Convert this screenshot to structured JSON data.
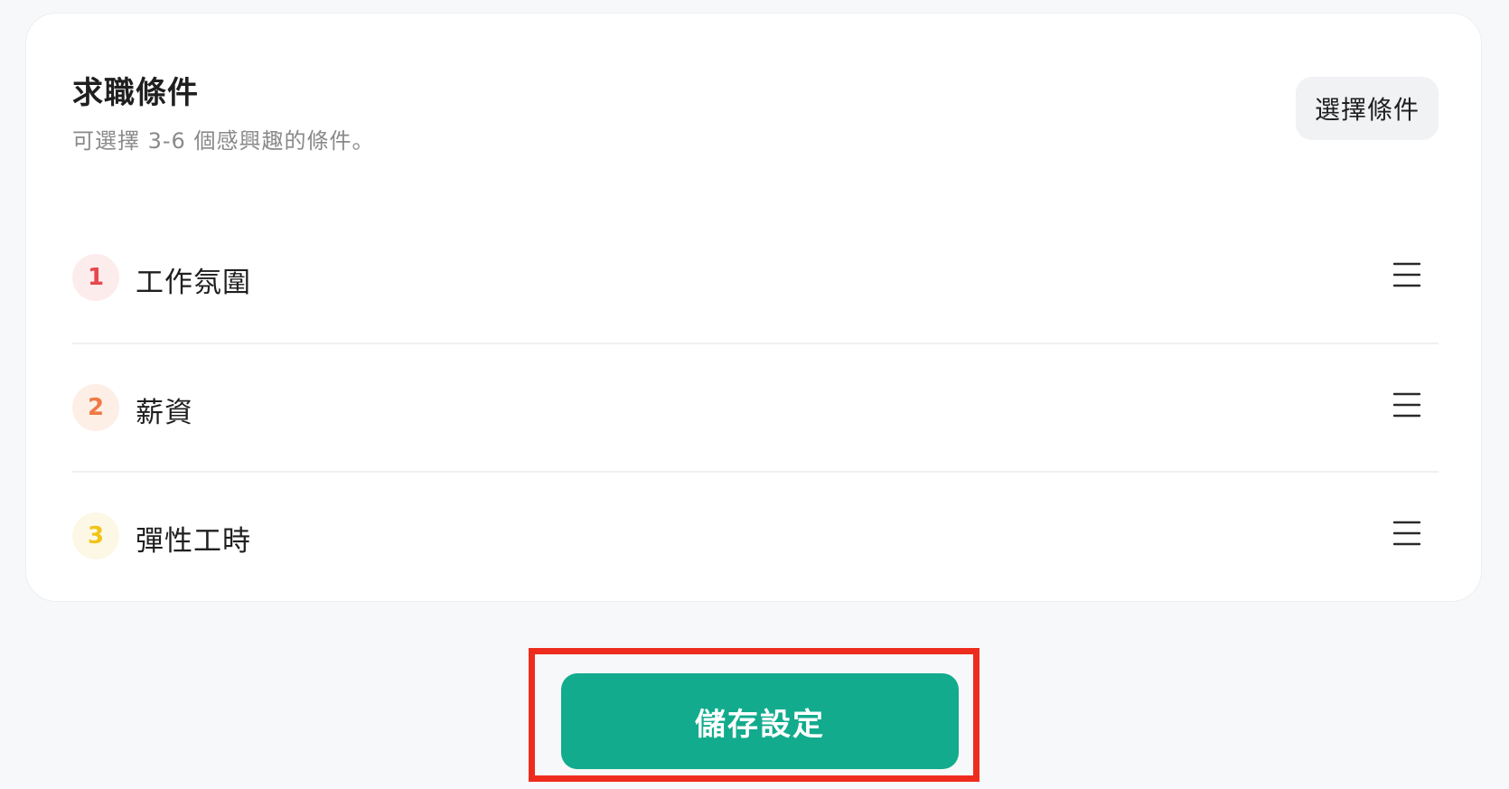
{
  "card": {
    "title": "求職條件",
    "subtitle": "可選擇 3-6 個感興趣的條件。",
    "select_label": "選擇條件"
  },
  "conditions": [
    {
      "number": "1",
      "label": "工作氛圍",
      "badge_bg": "#fdecec",
      "badge_color": "#e5484d"
    },
    {
      "number": "2",
      "label": "薪資",
      "badge_bg": "#fdeee6",
      "badge_color": "#ee7a45"
    },
    {
      "number": "3",
      "label": "彈性工時",
      "badge_bg": "#fdf8e6",
      "badge_color": "#f0c419"
    }
  ],
  "actions": {
    "save_label": "儲存設定"
  },
  "colors": {
    "primary": "#12ab8d",
    "highlight": "#ee2c1e"
  },
  "icons": {
    "drag_handle": "drag-handle-icon"
  }
}
